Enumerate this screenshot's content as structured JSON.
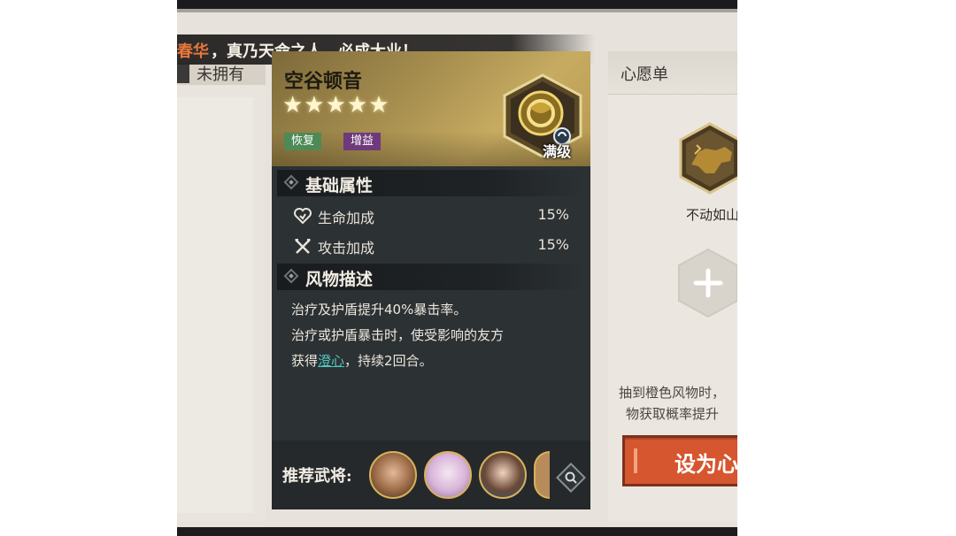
{
  "banner": {
    "accent": "春华",
    "text": "，真乃天命之人，必成大业！"
  },
  "left_panel": {
    "tab_label": "未拥有"
  },
  "card": {
    "name": "空谷顿音",
    "stars": "★★★★★",
    "rarity_stars": 5,
    "tags": [
      "恢复",
      "增益"
    ],
    "level_badge": "满级",
    "sections": {
      "attributes_title": "基础属性",
      "description_title": "风物描述"
    },
    "attributes": [
      {
        "icon": "heart-icon",
        "name": "生命加成",
        "value": "15%"
      },
      {
        "icon": "crossed-swords-icon",
        "name": "攻击加成",
        "value": "15%"
      }
    ],
    "description": {
      "line1": "治疗及护盾提升40%暴击率。",
      "line2": "治疗或护盾暴击时，使受影响的友方",
      "line3_prefix": "获得",
      "keyword": "澄心",
      "line3_suffix": "，持续2回合。"
    },
    "recommend_label": "推荐武将:"
  },
  "right_panel": {
    "title": "心愿单",
    "wish_item_name": "不动如山",
    "note_line1": "抽到橙色风物时，",
    "note_line2": "物获取概率提升",
    "set_button_label": "设为心愿"
  },
  "colors": {
    "accent_orange": "#e8783a",
    "button_orange": "#d6562f",
    "keyword_teal": "#4fc7c0",
    "tag_green": "#4e8a56",
    "tag_purple": "#6f3a7c",
    "card_gold": "#c7ab61"
  }
}
